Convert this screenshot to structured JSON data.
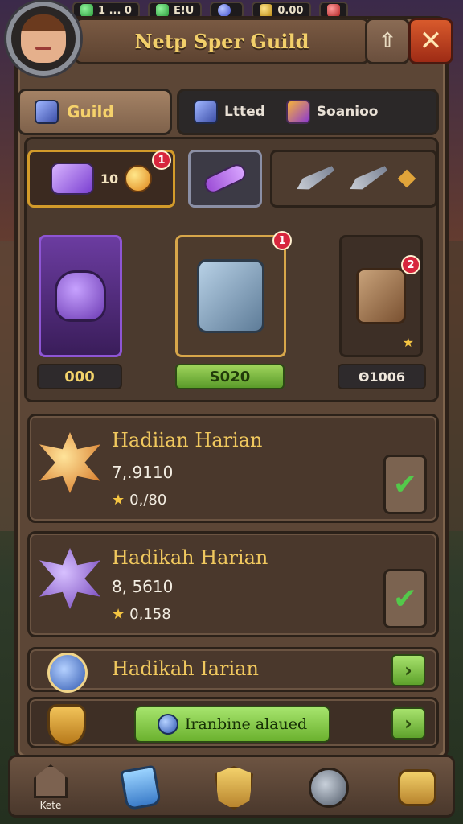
{
  "top_resources": [
    {
      "icon": "green-gem-icon",
      "value": "1 ... 0"
    },
    {
      "icon": "green-crystal-icon",
      "value": "E!U"
    },
    {
      "icon": "blue-orb-icon",
      "value": ""
    },
    {
      "icon": "gold-ingot-icon",
      "value": "0.00"
    },
    {
      "icon": "red-alert-icon",
      "value": ""
    }
  ],
  "header": {
    "title": "Netp Sper Guild",
    "up_label": "⇧",
    "close_label": "✕"
  },
  "tabs": {
    "guild": {
      "label": "Guild"
    },
    "other": [
      {
        "label": "Ltted"
      },
      {
        "label": "Soanioo"
      }
    ]
  },
  "slots": {
    "slot_a": {
      "count": "10",
      "badge": "1"
    },
    "slot_b": {},
    "slot_c": {}
  },
  "cards": [
    {
      "value": "000"
    },
    {
      "value": "S020",
      "badge": "1"
    },
    {
      "value": "Θ1006",
      "badge": "2"
    }
  ],
  "rows": [
    {
      "title": "Hadiian Harian",
      "sub": "7,.9110",
      "star_value": "0,/80",
      "action": "✔"
    },
    {
      "title": "Hadikah Harian",
      "sub": "8, 5610",
      "star_value": "0,158",
      "action": "✔"
    },
    {
      "title": "Hadikah Iarian",
      "action": "›"
    },
    {
      "pill_label": "Iranbine alaued",
      "action": "›"
    }
  ],
  "nav": [
    {
      "label": "Kete"
    },
    {
      "label": ""
    },
    {
      "label": ""
    },
    {
      "label": ""
    },
    {
      "label": ""
    }
  ],
  "colors": {
    "accent_gold": "#f2cf6a",
    "close_red": "#d85a2c",
    "action_green": "#a6e46d",
    "badge_red": "#d7263d"
  }
}
